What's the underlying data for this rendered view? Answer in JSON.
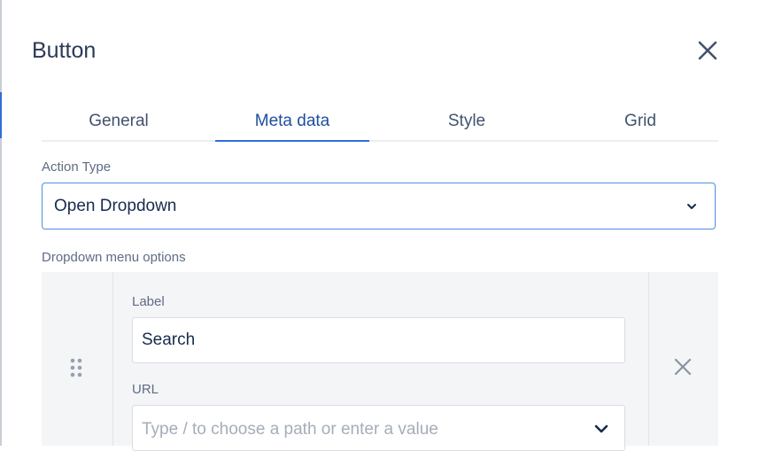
{
  "dialog": {
    "title": "Button"
  },
  "tabs": [
    {
      "label": "General",
      "active": false
    },
    {
      "label": "Meta data",
      "active": true
    },
    {
      "label": "Style",
      "active": false
    },
    {
      "label": "Grid",
      "active": false
    }
  ],
  "action_type": {
    "label": "Action Type",
    "value": "Open Dropdown"
  },
  "dropdown_options": {
    "label": "Dropdown menu options",
    "items": [
      {
        "label_field_label": "Label",
        "label_value": "Search",
        "url_field_label": "URL",
        "url_placeholder": "Type / to choose a path or enter a value"
      }
    ]
  },
  "colors": {
    "accent": "#2f6fd6",
    "focus_border": "#4c8de6",
    "panel_bg": "#f4f5f7"
  },
  "icons": {
    "close": "close-icon",
    "select_chevron": "chevron-down-icon",
    "drag": "drag-handle-icon",
    "remove": "remove-icon"
  }
}
